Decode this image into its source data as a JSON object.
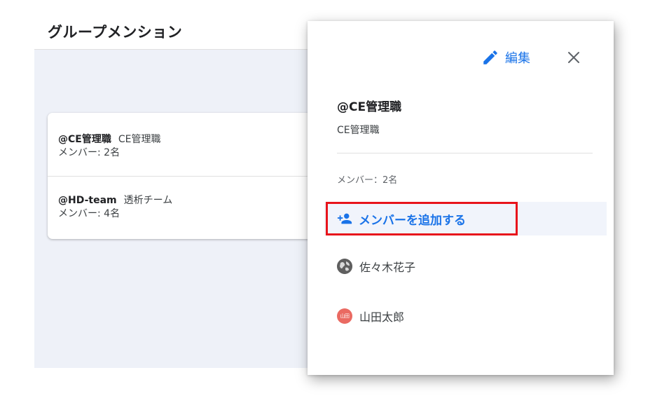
{
  "page": {
    "title": "グループメンション"
  },
  "groups": [
    {
      "handle": "@CE管理職",
      "name": "CE管理職",
      "members": "メンバー: 2名"
    },
    {
      "handle": "@HD-team",
      "name": "透析チーム",
      "members": "メンバー: 4名"
    }
  ],
  "detail": {
    "edit_icon": "pencil-icon",
    "edit_label": "編集",
    "close_icon": "close-icon",
    "handle": "@CE管理職",
    "name": "CE管理職",
    "member_count": "メンバー：2名",
    "add_member_icon": "person-add-icon",
    "add_member_label": "メンバーを追加する",
    "members": [
      {
        "name": "佐々木花子",
        "avatar": "globe-avatar"
      },
      {
        "name": "山田太郎",
        "avatar": "initials-avatar",
        "initials": "山田"
      }
    ]
  },
  "colors": {
    "accent": "#1a73e8",
    "highlight_border": "#e8141b",
    "list_background": "#eef1f8",
    "avatar_red": "#ea6a62"
  }
}
